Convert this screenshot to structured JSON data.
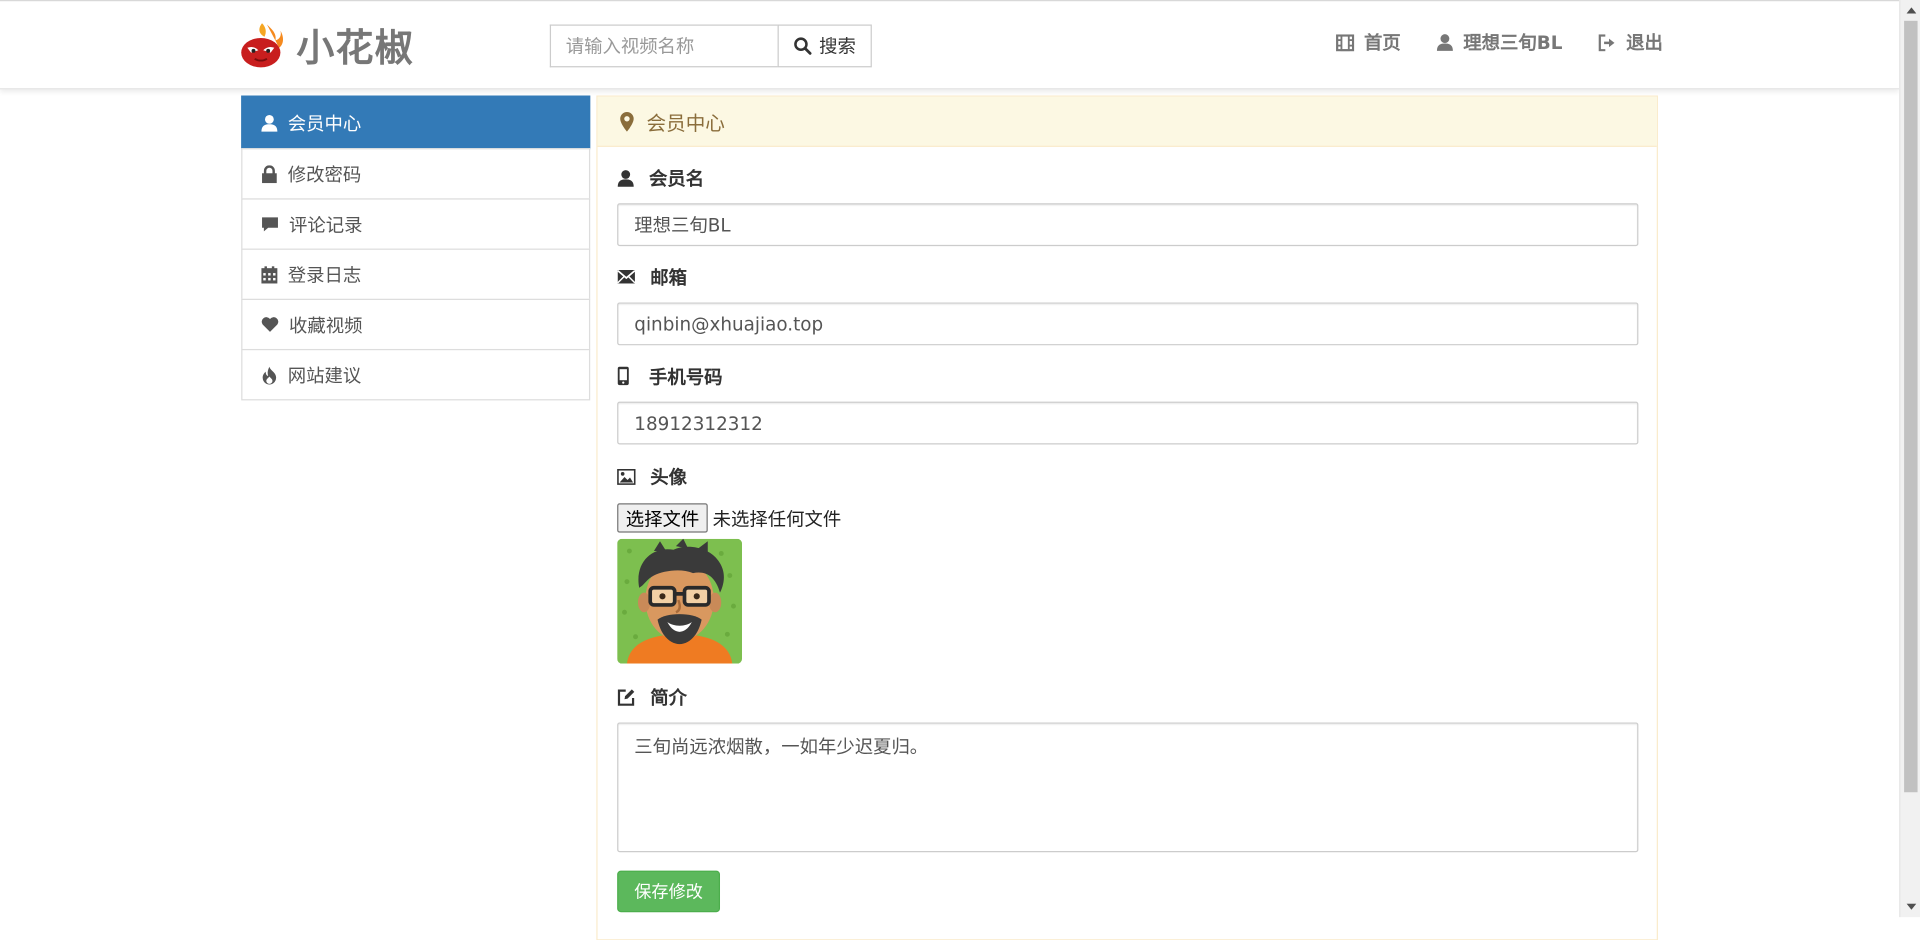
{
  "brand": {
    "name": "小花椒"
  },
  "search": {
    "placeholder": "请输入视频名称",
    "button_label": "搜索"
  },
  "nav": {
    "home_label": "首页",
    "user_label": "理想三旬BL",
    "logout_label": "退出"
  },
  "sidebar": {
    "items": [
      {
        "label": "会员中心",
        "icon": "user-icon",
        "active": true
      },
      {
        "label": "修改密码",
        "icon": "lock-icon"
      },
      {
        "label": "评论记录",
        "icon": "comment-icon"
      },
      {
        "label": "登录日志",
        "icon": "calendar-icon"
      },
      {
        "label": "收藏视频",
        "icon": "heart-icon"
      },
      {
        "label": "网站建议",
        "icon": "fire-icon"
      }
    ]
  },
  "panel": {
    "title": "会员中心",
    "fields": {
      "username": {
        "label": "会员名",
        "value": "理想三旬BL"
      },
      "email": {
        "label": "邮箱",
        "value": "qinbin@xhuajiao.top"
      },
      "phone": {
        "label": "手机号码",
        "value": "18912312312"
      },
      "avatar": {
        "label": "头像",
        "file_button": "选择文件",
        "file_status": "未选择任何文件"
      },
      "bio": {
        "label": "简介",
        "value": "三旬尚远浓烟散，一如年少迟夏归。"
      }
    },
    "save_label": "保存修改"
  },
  "colors": {
    "active": "#337ab7",
    "heading_bg": "#fcf8e3",
    "heading_text": "#8a6d3b",
    "save_button": "#5cb85c"
  }
}
